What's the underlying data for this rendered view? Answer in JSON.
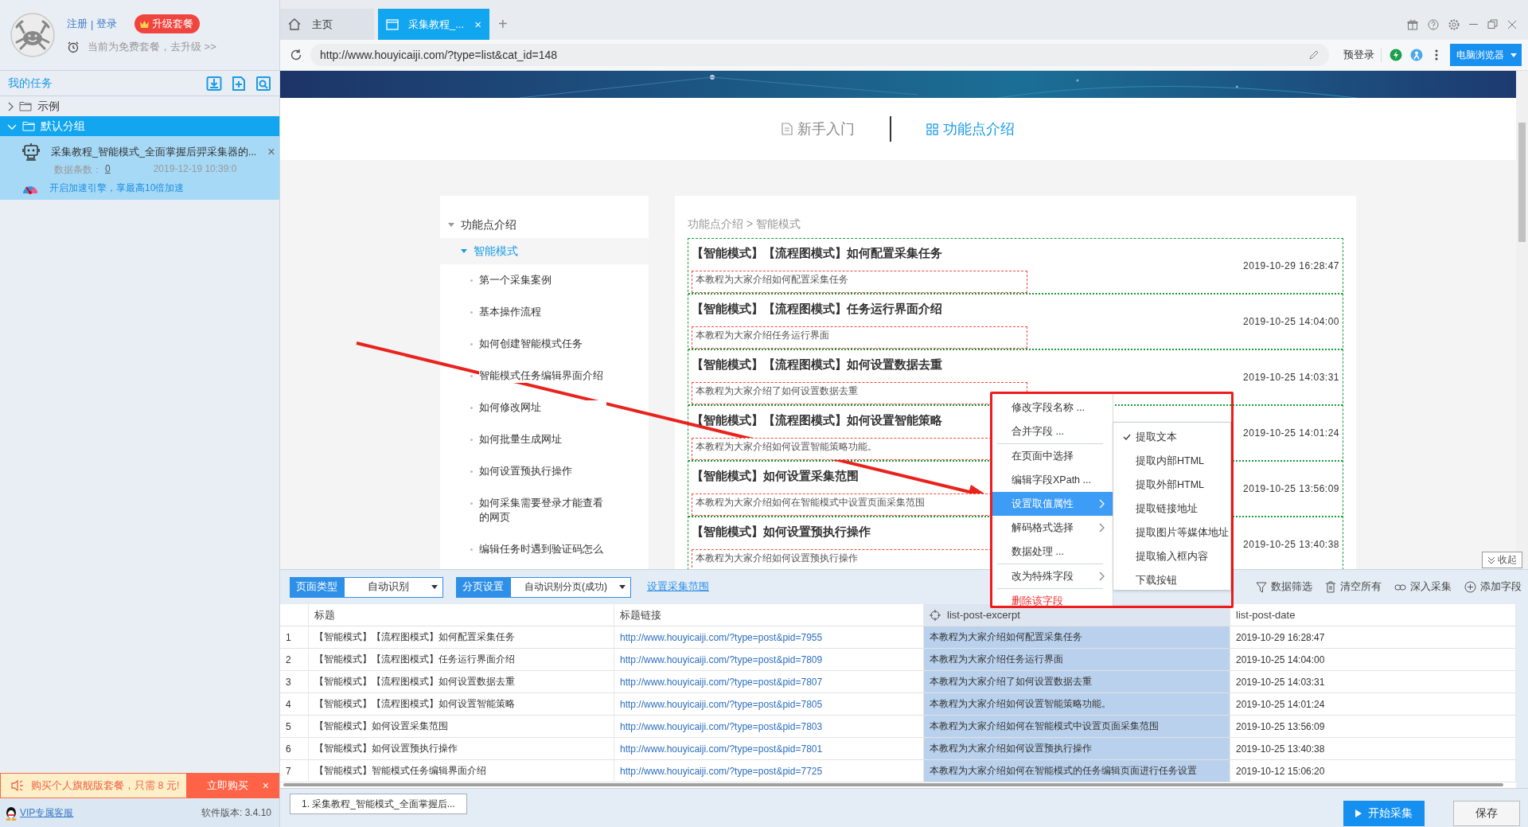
{
  "sidebar": {
    "account": {
      "register": "注册",
      "separator": "|",
      "login": "登录",
      "upgrade_badge": "升级套餐",
      "plan_notice": "当前为免费套餐，去升级 >>"
    },
    "tasks_title": "我的任务",
    "groups": [
      {
        "label": "示例",
        "expanded": false,
        "selected": false
      },
      {
        "label": "默认分组",
        "expanded": true,
        "selected": true,
        "tasks": [
          {
            "title": "采集教程_智能模式_全面掌握后羿采集器的...",
            "close": "×",
            "count_label": "数据条数：",
            "count": "0",
            "created": "2019-12-19 10:39:0",
            "boost": "开启加速引擎，享最高10倍加速"
          }
        ]
      }
    ],
    "promo": {
      "text": "购买个人旗舰版套餐，只需 8 元!",
      "button": "立即购买",
      "close": "×"
    },
    "footer": {
      "support": "VIP专属客服",
      "version": "软件版本: 3.4.10"
    }
  },
  "browser": {
    "tabs": [
      {
        "label": "主页",
        "kind": "home",
        "selected": false
      },
      {
        "label": "采集教程_...",
        "kind": "page",
        "selected": true
      }
    ],
    "tab_close": "×",
    "new_tab": "+",
    "url": "http://www.houyicaiji.com/?type=list&cat_id=148",
    "prelogin": "预登录",
    "mode_button": "电脑浏览器"
  },
  "web_page": {
    "nav_tabs": [
      {
        "label": "新手入门",
        "kind": "doc",
        "selected": false
      },
      {
        "label": "功能点介绍",
        "kind": "grid",
        "selected": true
      }
    ],
    "sidebar_tree": [
      {
        "label": "功能点介绍",
        "expanded": true,
        "selected": false,
        "children": [
          {
            "label": "智能模式",
            "expanded": true,
            "selected": true,
            "children": [
              {
                "label": "第一个采集案例",
                "selected": false
              },
              {
                "label": "基本操作流程",
                "selected": false
              },
              {
                "label": "如何创建智能模式任务",
                "selected": false
              },
              {
                "label": "智能模式任务编辑界面介绍",
                "selected": false
              },
              {
                "label": "如何修改网址",
                "selected": false
              },
              {
                "label": "如何批量生成网址",
                "selected": false
              },
              {
                "label": "如何设置预执行操作",
                "selected": false
              },
              {
                "label": "如何采集需要登录才能查看的网页",
                "selected": false
              },
              {
                "label": "编辑任务时遇到验证码怎么",
                "selected": false
              }
            ]
          }
        ]
      }
    ],
    "breadcrumb": "功能点介绍 > 智能模式",
    "articles": [
      {
        "title": "【智能模式】【流程图模式】如何配置采集任务",
        "excerpt": "本教程为大家介绍如何配置采集任务",
        "date": "2019-10-29 16:28:47"
      },
      {
        "title": "【智能模式】【流程图模式】任务运行界面介绍",
        "excerpt": "本教程为大家介绍任务运行界面",
        "date": "2019-10-25 14:04:00"
      },
      {
        "title": "【智能模式】【流程图模式】如何设置数据去重",
        "excerpt": "本教程为大家介绍了如何设置数据去重",
        "date": "2019-10-25 14:03:31"
      },
      {
        "title": "【智能模式】【流程图模式】如何设置智能策略",
        "excerpt": "本教程为大家介绍如何设置智能策略功能。",
        "date": "2019-10-25 14:01:24"
      },
      {
        "title": "【智能模式】如何设置采集范围",
        "excerpt": "本教程为大家介绍如何在智能模式中设置页面采集范围",
        "date": "2019-10-25 13:56:09"
      },
      {
        "title": "【智能模式】如何设置预执行操作",
        "excerpt": "本教程为大家介绍如何设置预执行操作",
        "date": "2019-10-25 13:40:38"
      }
    ],
    "collapse_button": "收起"
  },
  "context_menu": {
    "groups": [
      [
        {
          "label": "修改字段名称 ...",
          "kind": "normal",
          "selected": false,
          "submenu": false
        },
        {
          "label": "合并字段 ...",
          "kind": "normal",
          "selected": false,
          "submenu": false
        }
      ],
      [
        {
          "label": "在页面中选择",
          "kind": "normal",
          "selected": false,
          "submenu": false
        },
        {
          "label": "编辑字段XPath ...",
          "kind": "normal",
          "selected": false,
          "submenu": false
        },
        {
          "label": "设置取值属性",
          "kind": "normal",
          "selected": true,
          "submenu": true
        },
        {
          "label": "解码格式选择",
          "kind": "normal",
          "selected": false,
          "submenu": true
        },
        {
          "label": "数据处理 ...",
          "kind": "normal",
          "selected": false,
          "submenu": false
        }
      ],
      [
        {
          "label": "改为特殊字段",
          "kind": "normal",
          "selected": false,
          "submenu": true
        }
      ],
      [
        {
          "label": "删除该字段",
          "kind": "danger",
          "selected": false,
          "submenu": false
        }
      ]
    ],
    "submenu": [
      {
        "label": "提取文本",
        "checked": true
      },
      {
        "label": "提取内部HTML",
        "checked": false
      },
      {
        "label": "提取外部HTML",
        "checked": false
      },
      {
        "label": "提取链接地址",
        "checked": false
      },
      {
        "label": "提取图片等媒体地址",
        "checked": false
      },
      {
        "label": "提取输入框内容",
        "checked": false
      },
      {
        "label": "下载按钮",
        "checked": false
      }
    ]
  },
  "data_panel": {
    "toolbar": {
      "page_type_label": "页面类型",
      "page_type_value": "自动识别",
      "paging_label": "分页设置",
      "paging_value": "自动识别分页(成功)",
      "range_link": "设置采集范围",
      "actions": [
        {
          "label": "数据筛选",
          "kind": "filter"
        },
        {
          "label": "清空所有",
          "kind": "trash"
        },
        {
          "label": "深入采集",
          "kind": "link"
        },
        {
          "label": "添加字段",
          "kind": "add"
        }
      ]
    },
    "table": {
      "columns": [
        {
          "label": "标题",
          "selected": false
        },
        {
          "label": "标题链接",
          "selected": false
        },
        {
          "label": "list-post-excerpt",
          "selected": true
        },
        {
          "label": "list-post-date",
          "selected": false
        }
      ],
      "rows": [
        {
          "index": "1",
          "cells": [
            "【智能模式】【流程图模式】如何配置采集任务",
            "http://www.houyicaiji.com/?type=post&pid=7955",
            "本教程为大家介绍如何配置采集任务",
            "2019-10-29 16:28:47"
          ]
        },
        {
          "index": "2",
          "cells": [
            "【智能模式】【流程图模式】任务运行界面介绍",
            "http://www.houyicaiji.com/?type=post&pid=7809",
            "本教程为大家介绍任务运行界面",
            "2019-10-25 14:04:00"
          ]
        },
        {
          "index": "3",
          "cells": [
            "【智能模式】【流程图模式】如何设置数据去重",
            "http://www.houyicaiji.com/?type=post&pid=7807",
            "本教程为大家介绍了如何设置数据去重",
            "2019-10-25 14:03:31"
          ]
        },
        {
          "index": "4",
          "cells": [
            "【智能模式】【流程图模式】如何设置智能策略",
            "http://www.houyicaiji.com/?type=post&pid=7805",
            "本教程为大家介绍如何设置智能策略功能。",
            "2019-10-25 14:01:24"
          ]
        },
        {
          "index": "5",
          "cells": [
            "【智能模式】如何设置采集范围",
            "http://www.houyicaiji.com/?type=post&pid=7803",
            "本教程为大家介绍如何在智能模式中设置页面采集范围",
            "2019-10-25 13:56:09"
          ]
        },
        {
          "index": "6",
          "cells": [
            "【智能模式】如何设置预执行操作",
            "http://www.houyicaiji.com/?type=post&pid=7801",
            "本教程为大家介绍如何设置预执行操作",
            "2019-10-25 13:40:38"
          ]
        },
        {
          "index": "7",
          "cells": [
            "【智能模式】智能模式任务编辑界面介绍",
            "http://www.houyicaiji.com/?type=post&pid=7725",
            "本教程为大家介绍如何在智能模式的任务编辑页面进行任务设置",
            "2019-10-12 15:06:20"
          ]
        }
      ]
    },
    "task_tabs": [
      "1. 采集教程_智能模式_全面掌握后..."
    ],
    "start_button": "开始采集",
    "save_button": "保存"
  }
}
